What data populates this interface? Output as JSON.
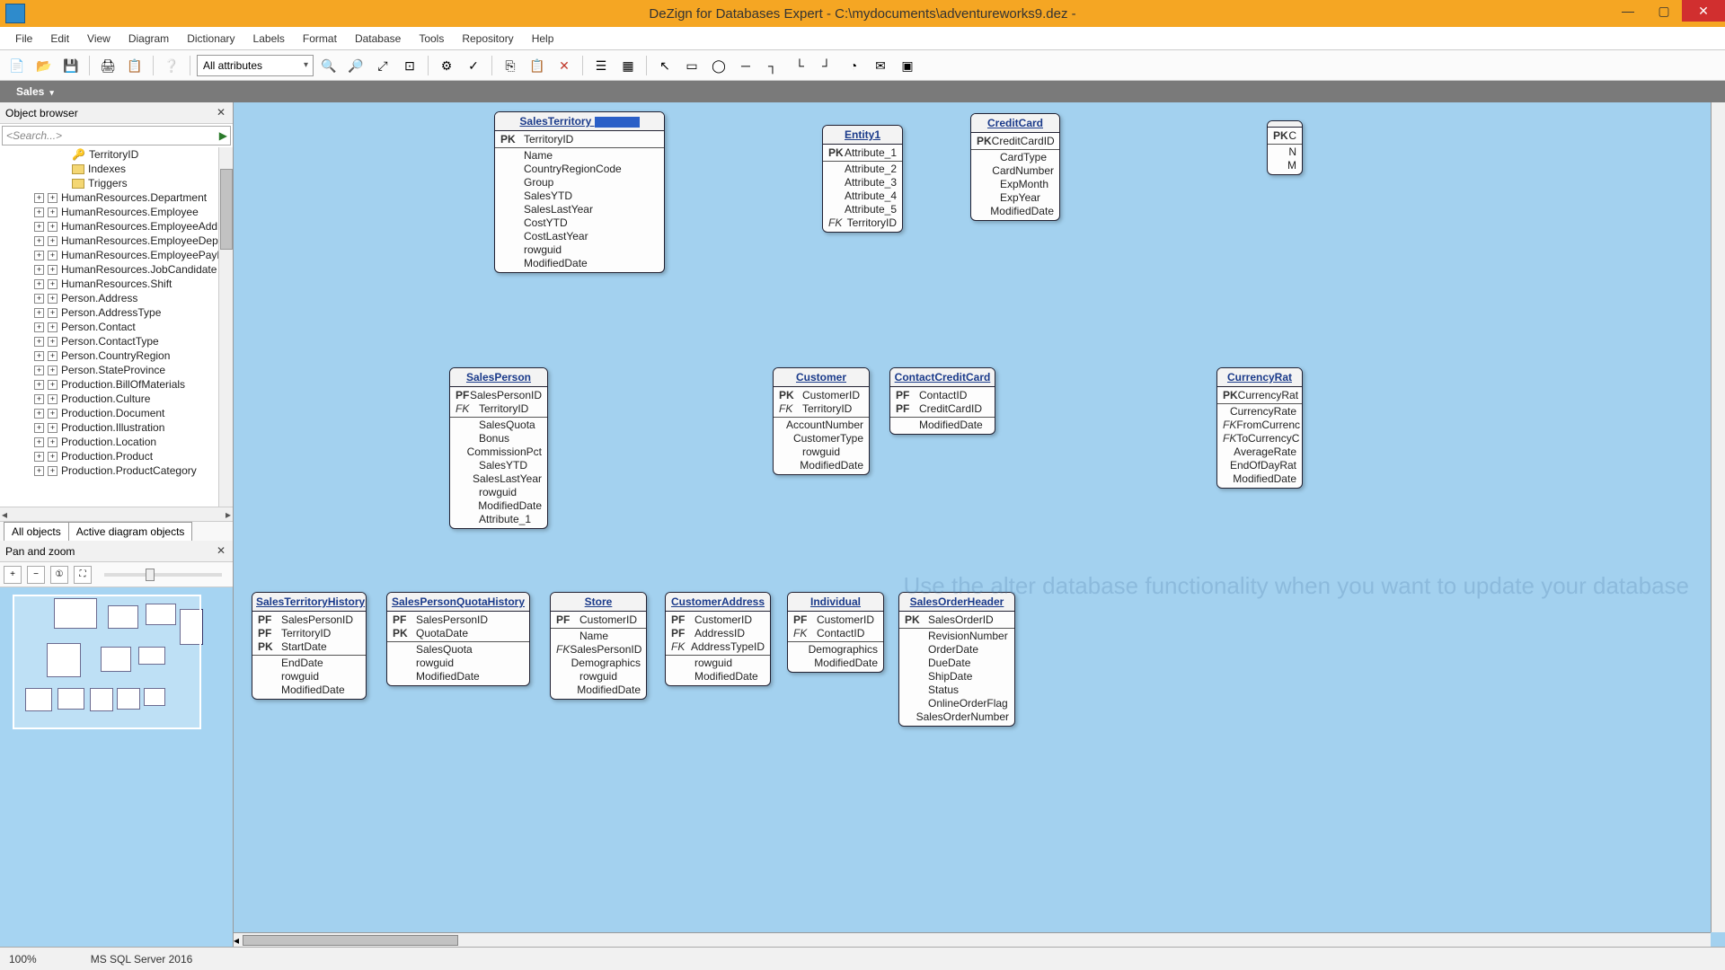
{
  "title": "DeZign for Databases Expert - C:\\mydocuments\\adventureworks9.dez -",
  "menu": [
    "File",
    "Edit",
    "View",
    "Diagram",
    "Dictionary",
    "Labels",
    "Format",
    "Database",
    "Tools",
    "Repository",
    "Help"
  ],
  "toolbar": {
    "attr_combo": "All attributes"
  },
  "active_tab": "Sales",
  "object_browser": {
    "title": "Object browser",
    "search_placeholder": "<Search...>",
    "top_items": [
      {
        "icon": "key",
        "label": "TerritoryID"
      },
      {
        "icon": "folder",
        "label": "Indexes"
      },
      {
        "icon": "folder",
        "label": "Triggers"
      }
    ],
    "items": [
      "HumanResources.Department",
      "HumanResources.Employee",
      "HumanResources.EmployeeAdd",
      "HumanResources.EmployeeDep",
      "HumanResources.EmployeePayH",
      "HumanResources.JobCandidate",
      "HumanResources.Shift",
      "Person.Address",
      "Person.AddressType",
      "Person.Contact",
      "Person.ContactType",
      "Person.CountryRegion",
      "Person.StateProvince",
      "Production.BillOfMaterials",
      "Production.Culture",
      "Production.Document",
      "Production.Illustration",
      "Production.Location",
      "Production.Product",
      "Production.ProductCategory"
    ],
    "tabs": [
      "All objects",
      "Active diagram objects"
    ]
  },
  "panzoom": {
    "title": "Pan and zoom"
  },
  "status": {
    "zoom": "100%",
    "db": "MS SQL Server 2016"
  },
  "entities": {
    "salesTerritory": {
      "title": "SalesTerritory",
      "selected": true,
      "rows": [
        [
          "PK",
          "TerritoryID"
        ],
        [
          "",
          "Name"
        ],
        [
          "",
          "CountryRegionCode"
        ],
        [
          "",
          "Group"
        ],
        [
          "",
          "SalesYTD"
        ],
        [
          "",
          "SalesLastYear"
        ],
        [
          "",
          "CostYTD"
        ],
        [
          "",
          "CostLastYear"
        ],
        [
          "",
          "rowguid"
        ],
        [
          "",
          "ModifiedDate"
        ]
      ]
    },
    "entity1": {
      "title": "Entity1",
      "rows": [
        [
          "PK",
          "Attribute_1"
        ],
        [
          "",
          "Attribute_2"
        ],
        [
          "",
          "Attribute_3"
        ],
        [
          "",
          "Attribute_4"
        ],
        [
          "",
          "Attribute_5"
        ],
        [
          "FK",
          "TerritoryID"
        ]
      ]
    },
    "creditCard": {
      "title": "CreditCard",
      "rows": [
        [
          "PK",
          "CreditCardID"
        ],
        [
          "",
          "CardType"
        ],
        [
          "",
          "CardNumber"
        ],
        [
          "",
          "ExpMonth"
        ],
        [
          "",
          "ExpYear"
        ],
        [
          "",
          "ModifiedDate"
        ]
      ]
    },
    "salesPerson": {
      "title": "SalesPerson",
      "rows": [
        [
          "PF",
          "SalesPersonID"
        ],
        [
          "FK",
          "TerritoryID"
        ],
        [
          "",
          "SalesQuota"
        ],
        [
          "",
          "Bonus"
        ],
        [
          "",
          "CommissionPct"
        ],
        [
          "",
          "SalesYTD"
        ],
        [
          "",
          "SalesLastYear"
        ],
        [
          "",
          "rowguid"
        ],
        [
          "",
          "ModifiedDate"
        ],
        [
          "",
          "Attribute_1"
        ]
      ]
    },
    "customer": {
      "title": "Customer",
      "rows": [
        [
          "PK",
          "CustomerID"
        ],
        [
          "FK",
          "TerritoryID"
        ],
        [
          "",
          "AccountNumber"
        ],
        [
          "",
          "CustomerType"
        ],
        [
          "",
          "rowguid"
        ],
        [
          "",
          "ModifiedDate"
        ]
      ]
    },
    "contactCreditCard": {
      "title": "ContactCreditCard",
      "rows": [
        [
          "PF",
          "ContactID"
        ],
        [
          "PF",
          "CreditCardID"
        ],
        [
          "",
          "ModifiedDate"
        ]
      ]
    },
    "currencyRate": {
      "title": "CurrencyRat",
      "rows": [
        [
          "PK",
          "CurrencyRat"
        ],
        [
          "",
          "CurrencyRate"
        ],
        [
          "FK",
          "FromCurrenc"
        ],
        [
          "FK",
          "ToCurrencyC"
        ],
        [
          "",
          "AverageRate"
        ],
        [
          "",
          "EndOfDayRat"
        ],
        [
          "",
          "ModifiedDate"
        ]
      ]
    },
    "salesTerritoryHistory": {
      "title": "SalesTerritoryHistory",
      "rows": [
        [
          "PF",
          "SalesPersonID"
        ],
        [
          "PF",
          "TerritoryID"
        ],
        [
          "PK",
          "StartDate"
        ],
        [
          "",
          "EndDate"
        ],
        [
          "",
          "rowguid"
        ],
        [
          "",
          "ModifiedDate"
        ]
      ]
    },
    "salesPersonQuotaHistory": {
      "title": "SalesPersonQuotaHistory",
      "rows": [
        [
          "PF",
          "SalesPersonID"
        ],
        [
          "PK",
          "QuotaDate"
        ],
        [
          "",
          "SalesQuota"
        ],
        [
          "",
          "rowguid"
        ],
        [
          "",
          "ModifiedDate"
        ]
      ]
    },
    "store": {
      "title": "Store",
      "rows": [
        [
          "PF",
          "CustomerID"
        ],
        [
          "",
          "Name"
        ],
        [
          "FK",
          "SalesPersonID"
        ],
        [
          "",
          "Demographics"
        ],
        [
          "",
          "rowguid"
        ],
        [
          "",
          "ModifiedDate"
        ]
      ]
    },
    "customerAddress": {
      "title": "CustomerAddress",
      "rows": [
        [
          "PF",
          "CustomerID"
        ],
        [
          "PF",
          "AddressID"
        ],
        [
          "FK",
          "AddressTypeID"
        ],
        [
          "",
          "rowguid"
        ],
        [
          "",
          "ModifiedDate"
        ]
      ]
    },
    "individual": {
      "title": "Individual",
      "rows": [
        [
          "PF",
          "CustomerID"
        ],
        [
          "FK",
          "ContactID"
        ],
        [
          "",
          "Demographics"
        ],
        [
          "",
          "ModifiedDate"
        ]
      ]
    },
    "salesOrderHeader": {
      "title": "SalesOrderHeader",
      "rows": [
        [
          "PK",
          "SalesOrderID"
        ],
        [
          "",
          "RevisionNumber"
        ],
        [
          "",
          "OrderDate"
        ],
        [
          "",
          "DueDate"
        ],
        [
          "",
          "ShipDate"
        ],
        [
          "",
          "Status"
        ],
        [
          "",
          "OnlineOrderFlag"
        ],
        [
          "",
          "SalesOrderNumber"
        ]
      ]
    },
    "cutoff": {
      "title": "",
      "rows": [
        [
          "PK",
          "C"
        ],
        [
          "",
          "N"
        ],
        [
          "",
          "M"
        ]
      ]
    }
  },
  "watermark": "Use the alter database functionality\nwhen you want to update your\ndatabase"
}
